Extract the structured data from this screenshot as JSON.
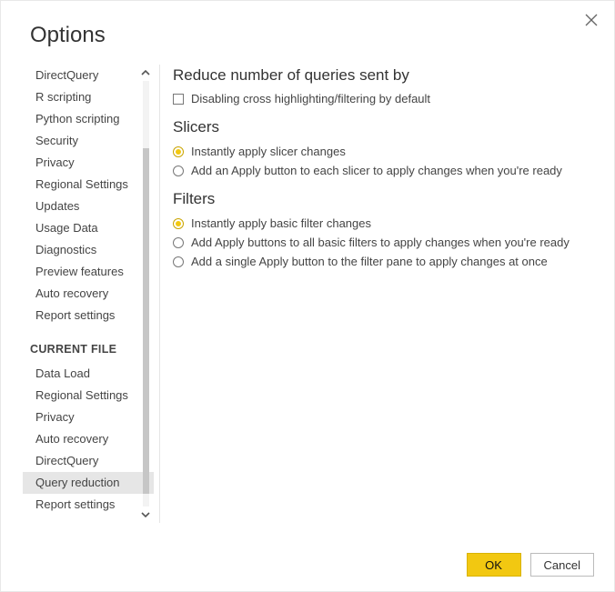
{
  "title": "Options",
  "sidebar": {
    "section_header": "CURRENT FILE",
    "items_global": [
      "DirectQuery",
      "R scripting",
      "Python scripting",
      "Security",
      "Privacy",
      "Regional Settings",
      "Updates",
      "Usage Data",
      "Diagnostics",
      "Preview features",
      "Auto recovery",
      "Report settings"
    ],
    "items_file": [
      "Data Load",
      "Regional Settings",
      "Privacy",
      "Auto recovery",
      "DirectQuery",
      "Query reduction",
      "Report settings"
    ],
    "selected": "Query reduction"
  },
  "content": {
    "reduce_heading": "Reduce number of queries sent by",
    "disable_checkbox": {
      "label": "Disabling cross highlighting/filtering by default",
      "checked": false
    },
    "slicers_heading": "Slicers",
    "slicers_options": [
      {
        "label": "Instantly apply slicer changes",
        "selected": true
      },
      {
        "label": "Add an Apply button to each slicer to apply changes when you're ready",
        "selected": false
      }
    ],
    "filters_heading": "Filters",
    "filters_options": [
      {
        "label": "Instantly apply basic filter changes",
        "selected": true
      },
      {
        "label": "Add Apply buttons to all basic filters to apply changes when you're ready",
        "selected": false
      },
      {
        "label": "Add a single Apply button to the filter pane to apply changes at once",
        "selected": false
      }
    ]
  },
  "footer": {
    "ok": "OK",
    "cancel": "Cancel"
  }
}
